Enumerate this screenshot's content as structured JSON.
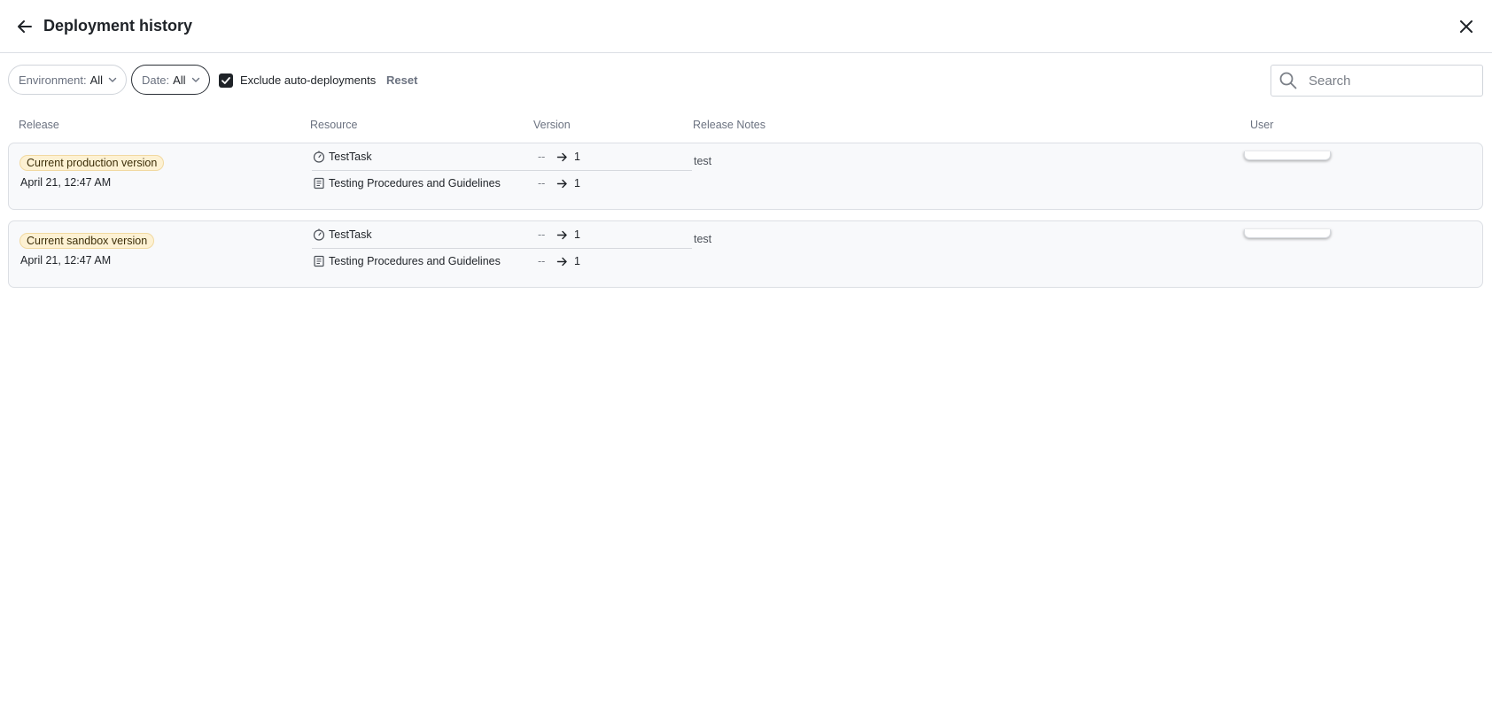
{
  "header": {
    "title": "Deployment history",
    "back_icon": "arrow-left-icon",
    "close_icon": "close-icon"
  },
  "filters": {
    "environment": {
      "key": "Environment:",
      "value": "All"
    },
    "date": {
      "key": "Date:",
      "value": "All"
    },
    "exclude_auto": {
      "label": "Exclude auto-deployments",
      "checked": true
    },
    "reset_label": "Reset",
    "search_placeholder": "Search"
  },
  "columns": {
    "release": "Release",
    "resource": "Resource",
    "version": "Version",
    "release_notes": "Release Notes",
    "user": "User"
  },
  "deployments": [
    {
      "badge": "Current production version",
      "date": "April 21, 12:47 AM",
      "resources": [
        {
          "icon": "timer-icon",
          "name": "TestTask",
          "from": "--",
          "to": "1"
        },
        {
          "icon": "document-icon",
          "name": "Testing Procedures and Guidelines",
          "from": "--",
          "to": "1"
        }
      ],
      "notes": "test"
    },
    {
      "badge": "Current sandbox version",
      "date": "April 21, 12:47 AM",
      "resources": [
        {
          "icon": "timer-icon",
          "name": "TestTask",
          "from": "--",
          "to": "1"
        },
        {
          "icon": "document-icon",
          "name": "Testing Procedures and Guidelines",
          "from": "--",
          "to": "1"
        }
      ],
      "notes": "test"
    }
  ],
  "colors": {
    "badge_bg": "#fdf1d3",
    "card_bg": "#f8f9fb",
    "accent_dark": "#1f2328"
  }
}
